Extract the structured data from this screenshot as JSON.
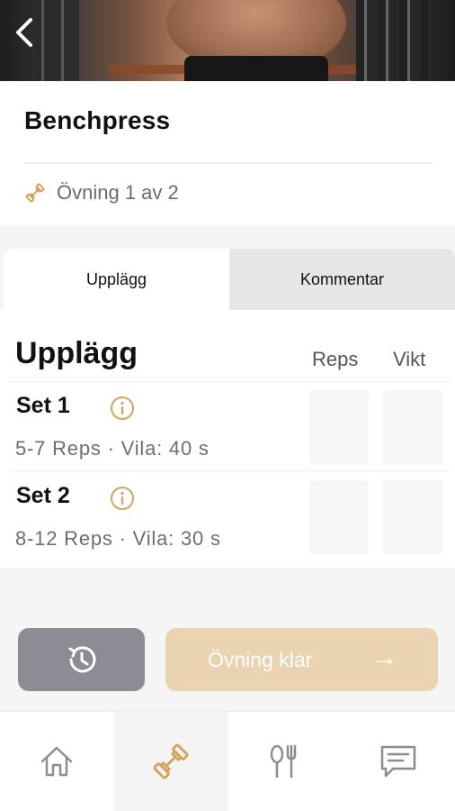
{
  "exercise": {
    "title": "Benchpress",
    "progress_text": "Övning 1 av 2"
  },
  "tabs": [
    {
      "label": "Upplägg",
      "active": true
    },
    {
      "label": "Kommentar",
      "active": false
    }
  ],
  "sets_section": {
    "title": "Upplägg",
    "columns": [
      "Reps",
      "Vikt"
    ],
    "sets": [
      {
        "name": "Set 1",
        "meta": "5-7 Reps  ·  Vila: 40 s",
        "reps_value": "",
        "weight_value": ""
      },
      {
        "name": "Set 2",
        "meta": "8-12 Reps  ·  Vila: 30 s",
        "reps_value": "",
        "weight_value": ""
      }
    ]
  },
  "actions": {
    "history_icon": "history-icon",
    "done_label": "Övning klar",
    "done_arrow": "→"
  },
  "bottom_nav": {
    "items": [
      {
        "icon": "home-icon",
        "active": false
      },
      {
        "icon": "dumbbell-icon",
        "active": true
      },
      {
        "icon": "fork-knife-icon",
        "active": false
      },
      {
        "icon": "chat-icon",
        "active": false
      }
    ]
  },
  "colors": {
    "accent": "#d2a45f",
    "accent_light": "#e9d3b1",
    "history_button": "#8c8d94"
  }
}
